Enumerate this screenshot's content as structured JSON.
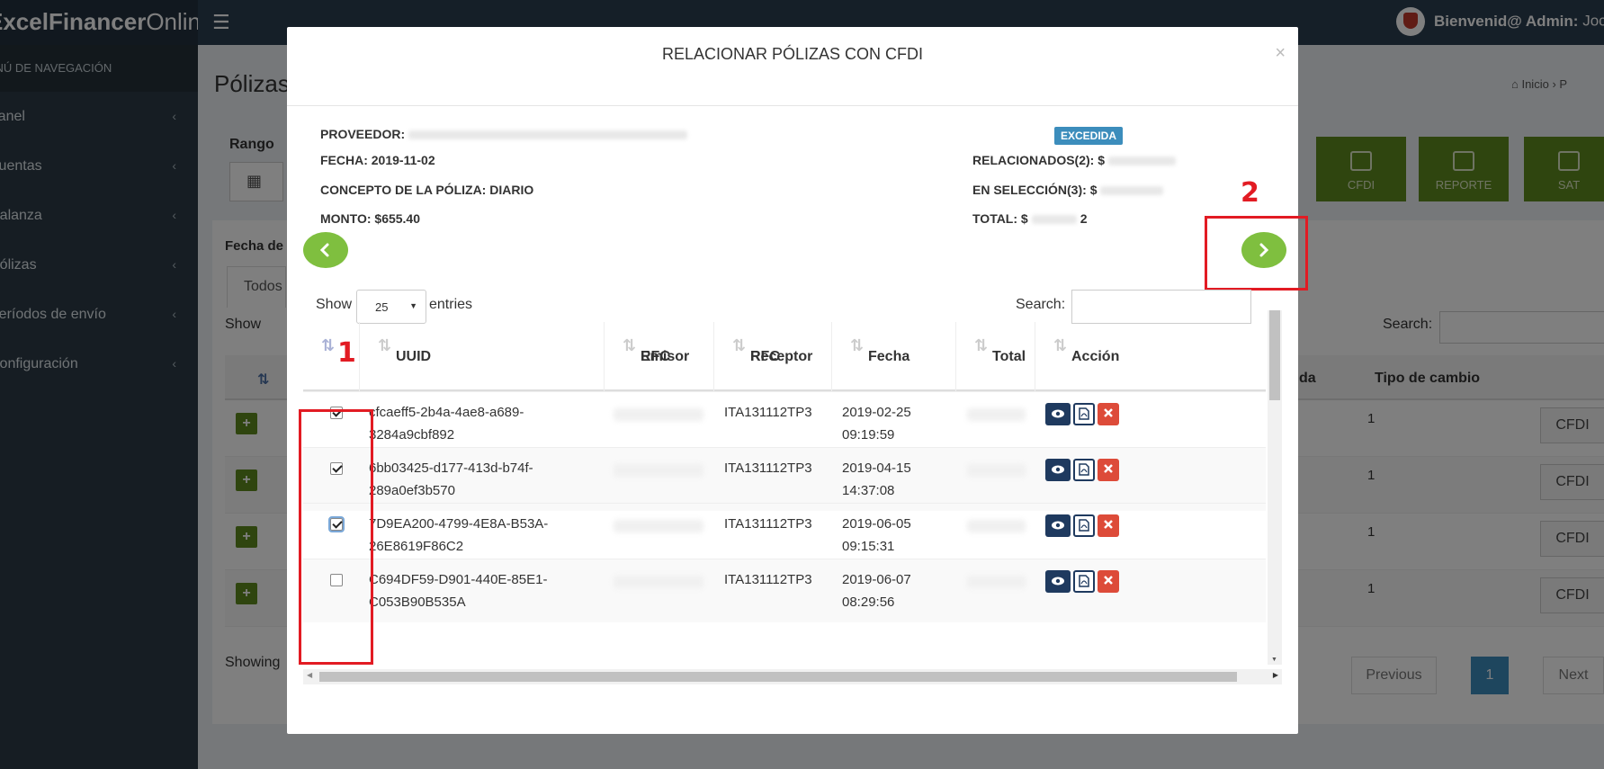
{
  "app": {
    "brand_bold": "ExcelFinancer",
    "brand_light": "Online",
    "welcome_bold": "Bienvenid@ Admin:",
    "welcome_name": "Joce"
  },
  "sidebar": {
    "header": "MENÚ DE NAVEGACIÓN",
    "items": [
      {
        "label": "Panel"
      },
      {
        "label": "Cuentas"
      },
      {
        "label": "Balanza"
      },
      {
        "label": "Pólizas"
      },
      {
        "label": "Períodos de envío"
      },
      {
        "label": "Configuración"
      }
    ]
  },
  "background": {
    "page_title": "Pólizas",
    "breadcrumb_home": "Inicio",
    "breadcrumb_sep": "›  P",
    "range_label": "Rango",
    "buttons": [
      {
        "label": "CFDI"
      },
      {
        "label": "REPORTE"
      },
      {
        "label": "SAT"
      }
    ],
    "date_filter_label": "Fecha de",
    "tab_all": "Todos",
    "show_label": "Show",
    "search_label": "Search:",
    "col_partial": "da",
    "col_exchange": "Tipo de cambio",
    "row_value": "1",
    "row_button": "CFDI",
    "showing_label": "Showing",
    "pagination": {
      "previous": "Previous",
      "page": "1",
      "next": "Next"
    }
  },
  "modal": {
    "title": "RELACIONAR PÓLIZAS CON CFDI",
    "close_symbol": "×",
    "proveedor_label": "PROVEEDOR:",
    "fecha": "FECHA: 2019-11-02",
    "concepto": "CONCEPTO DE LA PÓLIZA: DIARIO",
    "monto": "MONTO: $655.40",
    "status_badge": "EXCEDIDA",
    "relacionados": "RELACIONADOS(2):",
    "relacionados_prefix": "$",
    "en_seleccion": "EN SELECCIÓN(3):",
    "en_seleccion_prefix": "$",
    "total": "TOTAL:",
    "total_prefix": "$",
    "total_suffix": "2",
    "annotation_1": "1",
    "annotation_2": "2",
    "show_label": "Show",
    "entries_value": "25",
    "entries_label": "entries",
    "search_label": "Search:",
    "search_value": "",
    "columns": [
      {
        "line1": "",
        "line2": "UUID"
      },
      {
        "line1": "RFC",
        "line2": "Emisor"
      },
      {
        "line1": "RFC",
        "line2": "Receptor"
      },
      {
        "line1": "",
        "line2": "Fecha"
      },
      {
        "line1": "",
        "line2": "Total"
      },
      {
        "line1": "",
        "line2": "Acción"
      }
    ],
    "rows": [
      {
        "uuid1": "cfcaeff5-2b4a-4ae8-a689-",
        "uuid2": "3284a9cbf892",
        "receptor": "ITA131112TP3",
        "date": "2019-02-25",
        "time": "09:19:59",
        "checked": true
      },
      {
        "uuid1": "6bb03425-d177-413d-b74f-",
        "uuid2": "289a0ef3b570",
        "receptor": "ITA131112TP3",
        "date": "2019-04-15",
        "time": "14:37:08",
        "checked": true
      },
      {
        "uuid1": "7D9EA200-4799-4E8A-B53A-",
        "uuid2": "26E8619F86C2",
        "receptor": "ITA131112TP3",
        "date": "2019-06-05",
        "time": "09:15:31",
        "checked": true
      },
      {
        "uuid1": "C694DF59-D901-440E-85E1-",
        "uuid2": "C053B90B535A",
        "receptor": "ITA131112TP3",
        "date": "2019-06-07",
        "time": "08:29:56",
        "checked": false
      }
    ]
  },
  "icons": {
    "prev": "chevron-left-icon",
    "next": "chevron-right-icon",
    "view": "eye-icon",
    "pdf": "pdf-icon",
    "delete": "close-icon"
  },
  "colors": {
    "topbar": "#2b3e50",
    "sidebar": "#2c3b47",
    "badge": "#3c8dbc",
    "nav_buttons": "#7fbf3f",
    "action_dark": "#1f3a5f",
    "action_red": "#dd4b39",
    "annotation_red": "#e21b23",
    "bg_buttons": "#5f8a1f"
  }
}
